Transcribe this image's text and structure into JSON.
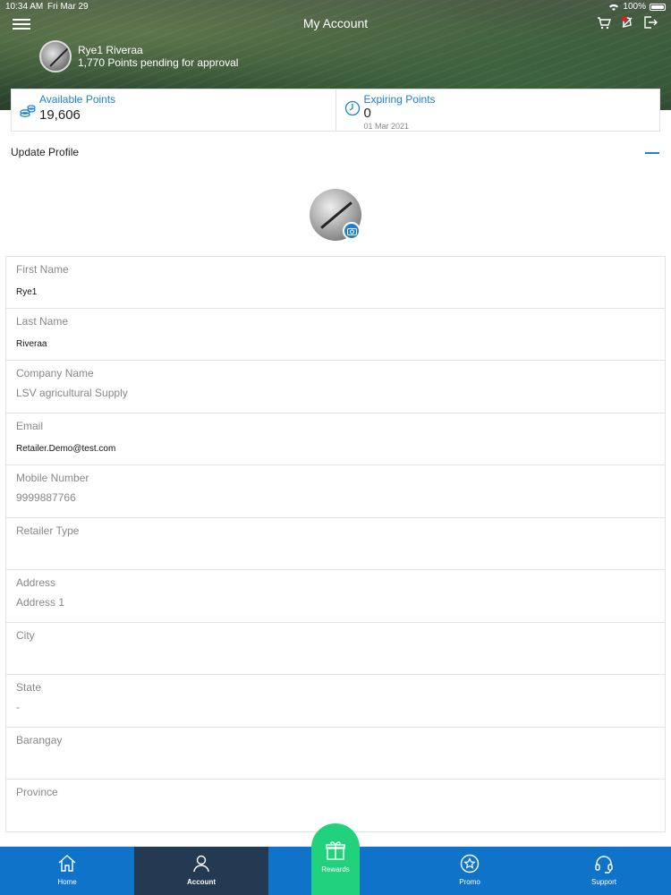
{
  "status_bar": {
    "time": "10:34 AM",
    "date": "Fri Mar 29",
    "battery": "100%"
  },
  "header": {
    "title": "My Account"
  },
  "profile": {
    "name": "Rye1 Riveraa",
    "pending": "1,770 Points pending for approval"
  },
  "points": {
    "available_label": "Available Points",
    "available_value": "19,606",
    "expiring_label": "Expiring Points",
    "expiring_value": "0",
    "expiring_date": "01 Mar 2021"
  },
  "section": {
    "title": "Update Profile"
  },
  "form": {
    "fields": [
      {
        "label": "First Name",
        "value": "Rye1"
      },
      {
        "label": "Last Name",
        "value": "Riveraa"
      },
      {
        "label": "Company Name",
        "value": "LSV agricultural Supply"
      },
      {
        "label": "Email",
        "value": "Retailer.Demo@test.com"
      },
      {
        "label": "Mobile Number",
        "value": "9999887766"
      },
      {
        "label": "Retailer Type",
        "value": ""
      },
      {
        "label": "Address",
        "value": "Address 1"
      },
      {
        "label": "City",
        "value": ""
      },
      {
        "label": "State",
        "value": "-"
      },
      {
        "label": "Barangay",
        "value": ""
      },
      {
        "label": "Province",
        "value": ""
      }
    ]
  },
  "nav": {
    "items": [
      {
        "label": "Home",
        "icon": "home-icon"
      },
      {
        "label": "Account",
        "icon": "user-icon"
      },
      {
        "label": "Rewards",
        "icon": "gift-icon"
      },
      {
        "label": "Promo",
        "icon": "star-badge-icon"
      },
      {
        "label": "Support",
        "icon": "headset-icon"
      }
    ]
  },
  "colors": {
    "accent": "#1f7fd4",
    "nav": "#0f73c9",
    "nav_active": "#243a52",
    "rewards": "#22d17c"
  }
}
